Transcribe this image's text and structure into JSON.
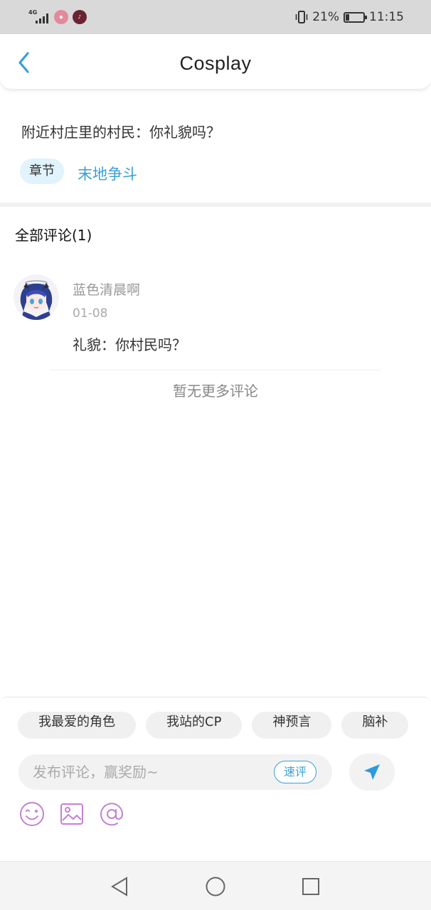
{
  "status_bar": {
    "network": "4G",
    "battery_text": "21%",
    "battery_level": 0.21,
    "time": "11:15",
    "app_icons": [
      "app-notification-icon",
      "tiktok-icon"
    ]
  },
  "header": {
    "title": "Cosplay",
    "back_icon": "chevron-left-icon"
  },
  "post": {
    "text": "附近村庄里的村民：你礼貌吗？",
    "chapter_tag": "章节",
    "chapter_name": "末地争斗"
  },
  "comments": {
    "title": "全部评论(1)",
    "items": [
      {
        "username": "蓝色清晨啊",
        "date": "01-08",
        "body": "礼貌：你村民吗？",
        "avatar": "anime-avatar"
      }
    ],
    "no_more": "暂无更多评论"
  },
  "compose": {
    "quick_tags": [
      "我最爱的角色",
      "我站的CP",
      "神预言",
      "脑补"
    ],
    "placeholder": "发布评论，赢奖励~",
    "quick_label": "速评",
    "send_icon": "send-icon",
    "tools": [
      "emoji-icon",
      "image-icon",
      "at-icon"
    ]
  },
  "nav_bar": {
    "buttons": [
      "back-triangle-icon",
      "home-circle-icon",
      "recents-square-icon"
    ]
  },
  "colors": {
    "accent": "#3a9fd8",
    "tag_bg": "#e1f3fc",
    "tool_icon": "#c67fd6"
  }
}
